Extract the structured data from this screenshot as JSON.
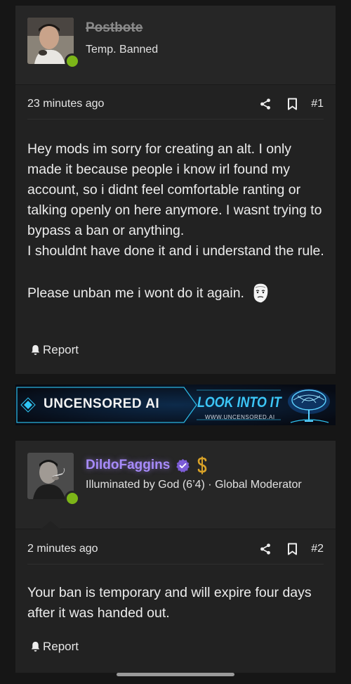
{
  "posts": [
    {
      "username": "Postbote",
      "user_title": "Temp. Banned",
      "time": "23 minutes ago",
      "number": "#1",
      "body_lines": [
        "Hey mods im sorry for creating an alt. I only made it because people i know irl found my account, so i didnt feel comfortable ranting or talking openly on here anymore. I wasnt trying to bypass a ban or anything.",
        "I shouldnt have done it and i understand the rule.",
        "Please unban me i wont do it again."
      ],
      "report_label": "Report"
    },
    {
      "username": "DildoFaggins",
      "user_title": "Illuminated by God (6’4) · Global Moderator",
      "time": "2 minutes ago",
      "number": "#2",
      "body_lines": [
        "Your ban is temporary and will expire four days after it was handed out."
      ],
      "report_label": "Report"
    }
  ],
  "ad": {
    "brand": "UNCENSORED AI",
    "cta": "LOOK INTO IT",
    "url": "WWW.UNCENSORED.AI"
  },
  "colors": {
    "background": "#161616",
    "card": "#222222",
    "online": "#7cb518",
    "moderator_name": "#a78bfa",
    "verified_badge": "#7c5cd6",
    "ad_cyan": "#2fc6f5"
  },
  "icons": {
    "share": "share-icon",
    "bookmark": "bookmark-icon",
    "report": "bell-icon",
    "verified": "verified-badge-icon",
    "dollar": "dollar-icon",
    "emoji": "pepe-face-icon"
  }
}
